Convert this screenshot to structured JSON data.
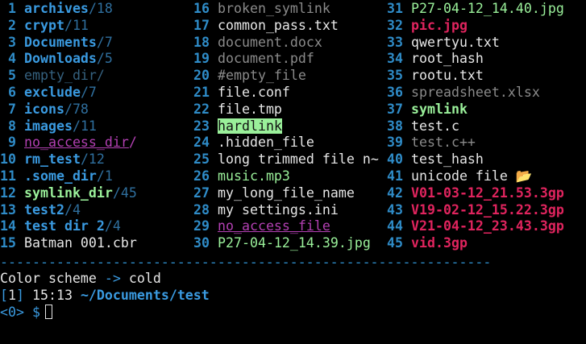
{
  "listing": {
    "col0": [
      {
        "n": "1",
        "name": "archives",
        "count": "/18",
        "t": "dir"
      },
      {
        "n": "2",
        "name": "crypt",
        "count": "/11",
        "t": "dir"
      },
      {
        "n": "3",
        "name": "Documents",
        "count": "/7",
        "t": "dir"
      },
      {
        "n": "4",
        "name": "Downloads",
        "count": "/5",
        "t": "dir"
      },
      {
        "n": "5",
        "name": "empty_dir/",
        "count": "",
        "t": "dir-empty"
      },
      {
        "n": "6",
        "name": "exclude",
        "count": "/7",
        "t": "dir"
      },
      {
        "n": "7",
        "name": "icons",
        "count": "/78",
        "t": "dir"
      },
      {
        "n": "8",
        "name": "images",
        "count": "/11",
        "t": "dir"
      },
      {
        "n": "9",
        "name": "no_access_dir",
        "count": "/",
        "t": "noaccess-dir"
      },
      {
        "n": "10",
        "name": "rm_test",
        "count": "/12",
        "t": "dir"
      },
      {
        "n": "11",
        "name": ".some_dir",
        "count": "/1",
        "t": "dir"
      },
      {
        "n": "12",
        "name": "symlink_dir",
        "count": "/45",
        "t": "symdir"
      },
      {
        "n": "13",
        "name": "test2",
        "count": "/4",
        "t": "dir"
      },
      {
        "n": "14",
        "name": "test dir 2",
        "count": "/4",
        "t": "dir"
      },
      {
        "n": "15",
        "name": "Batman 001.cbr",
        "count": "",
        "t": "plain"
      }
    ],
    "col1": [
      {
        "n": "16",
        "name": "broken_symlink",
        "t": "broken"
      },
      {
        "n": "17",
        "name": "common_pass.txt",
        "t": "plain"
      },
      {
        "n": "18",
        "name": "document.docx",
        "t": "hidden-grey"
      },
      {
        "n": "19",
        "name": "document.pdf",
        "t": "hidden-grey"
      },
      {
        "n": "20",
        "name": "#empty_file",
        "t": "hidden-grey"
      },
      {
        "n": "21",
        "name": "file.conf",
        "t": "plain"
      },
      {
        "n": "22",
        "name": "file.tmp",
        "t": "plain"
      },
      {
        "n": "23",
        "name": "hardlink",
        "t": "hardlink"
      },
      {
        "n": "24",
        "name": ".hidden_file",
        "t": "plain"
      },
      {
        "n": "25",
        "name": "long trimmed file n~",
        "t": "plain"
      },
      {
        "n": "26",
        "name": "music.mp3",
        "t": "audio"
      },
      {
        "n": "27",
        "name": "my_long_file_name",
        "t": "plain"
      },
      {
        "n": "28",
        "name": "my settings.ini",
        "t": "plain"
      },
      {
        "n": "29",
        "name": "no_access_file",
        "t": "noaccess"
      },
      {
        "n": "30",
        "name": "P27-04-12_14.39.jpg",
        "t": "image"
      }
    ],
    "col2": [
      {
        "n": "31",
        "name": "P27-04-12_14.40.jpg",
        "t": "image"
      },
      {
        "n": "32",
        "name": "pic.jpg",
        "t": "image-hot"
      },
      {
        "n": "33",
        "name": "qwertyu.txt",
        "t": "plain"
      },
      {
        "n": "34",
        "name": "root_hash",
        "t": "plain"
      },
      {
        "n": "35",
        "name": "rootu.txt",
        "t": "plain"
      },
      {
        "n": "36",
        "name": "spreadsheet.xlsx",
        "t": "hidden-grey"
      },
      {
        "n": "37",
        "name": "symlink",
        "t": "symlink"
      },
      {
        "n": "38",
        "name": "test.c",
        "t": "plain"
      },
      {
        "n": "39",
        "name": "test.c++",
        "t": "hidden-grey"
      },
      {
        "n": "40",
        "name": "test_hash",
        "t": "plain"
      },
      {
        "n": "41",
        "name": "unicode file 📂",
        "t": "plain"
      },
      {
        "n": "42",
        "name": "V01-03-12_21.53.3gp",
        "t": "video"
      },
      {
        "n": "43",
        "name": "V19-02-12_15.22.3gp",
        "t": "video"
      },
      {
        "n": "44",
        "name": "V21-04-12_23.43.3gp",
        "t": "video"
      },
      {
        "n": "45",
        "name": "vid.3gp",
        "t": "video"
      }
    ]
  },
  "divider": "-------------------------------------------------------------",
  "status": {
    "scheme_label": "Color scheme ",
    "scheme_arrow": "->",
    "scheme_value": " cold",
    "ws_open": "[",
    "ws_num": "1",
    "ws_close": "]",
    "time": " 15:13 ",
    "path": "~/Documents/test",
    "prompt_code": "<0>",
    "prompt_symbol": " $"
  },
  "colors": {
    "background": "#000000",
    "number": "#2f8cc8",
    "directory": "#3a9ae0",
    "symlink": "#9af09a",
    "video": "#e0245e",
    "no_access": "#b340b3",
    "muted": "#8a8a8a"
  }
}
